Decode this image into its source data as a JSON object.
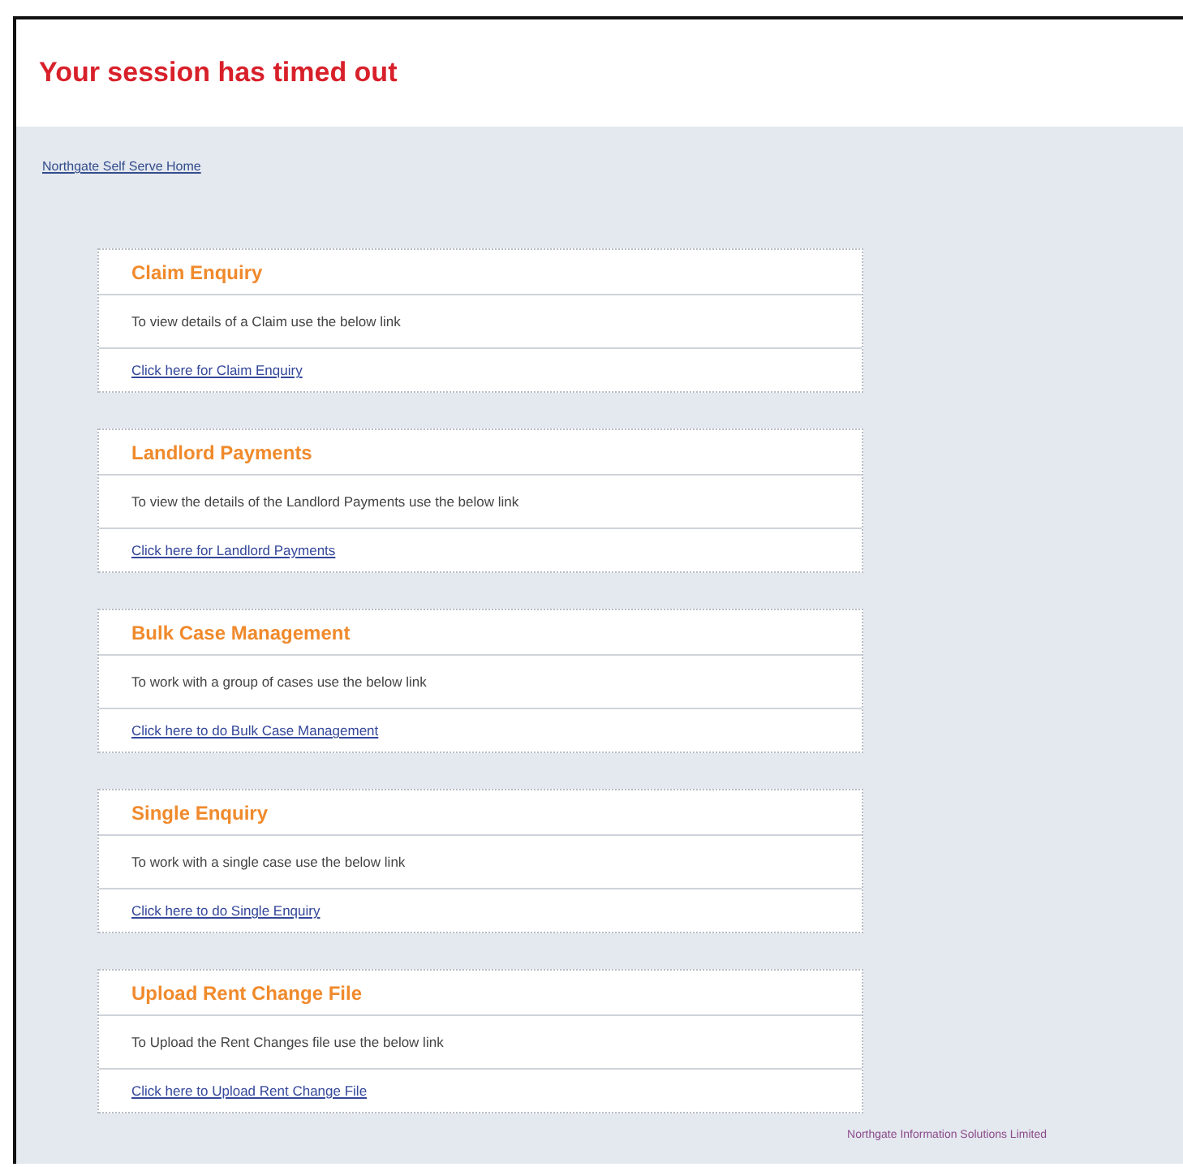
{
  "title": "Your session has timed out",
  "home_link": "Northgate Self Serve Home",
  "sections": [
    {
      "heading": "Claim Enquiry",
      "description": "To view details of a Claim use the below link",
      "link": "Click here for Claim Enquiry"
    },
    {
      "heading": "Landlord Payments",
      "description": "To view the details of the Landlord Payments use the below link",
      "link": "Click here for Landlord Payments"
    },
    {
      "heading": "Bulk Case Management",
      "description": "To work with a group of cases use the below link",
      "link": "Click here to do Bulk Case Management"
    },
    {
      "heading": "Single Enquiry",
      "description": "To work with a single case use the below link",
      "link": "Click here to do Single Enquiry"
    },
    {
      "heading": "Upload Rent Change File",
      "description": "To Upload the Rent Changes file use the below link",
      "link": "Click here to Upload Rent Change File"
    }
  ],
  "footer": "Northgate Information Solutions Limited"
}
